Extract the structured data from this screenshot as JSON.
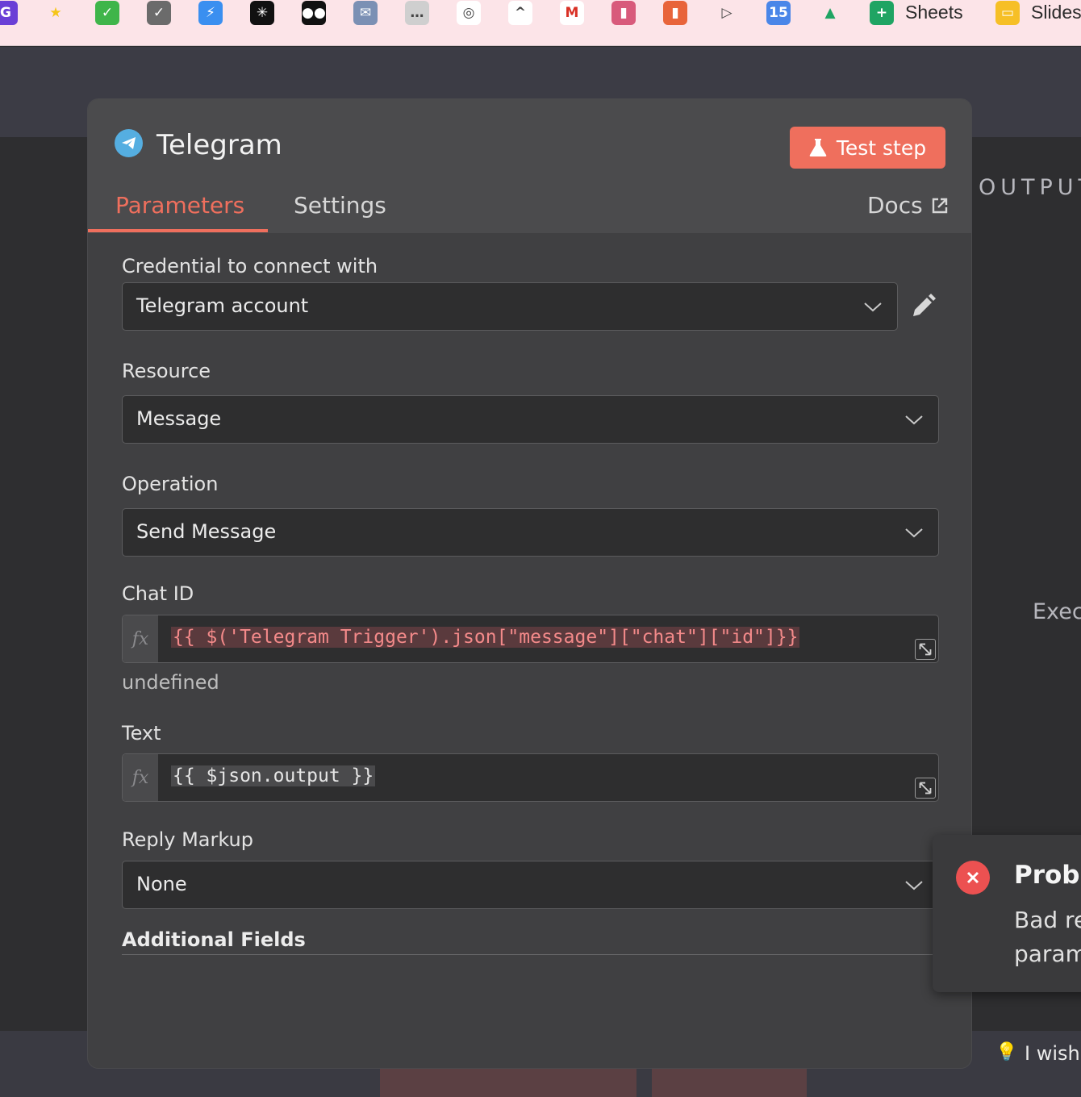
{
  "bookmarks": {
    "items": [
      {
        "icon": "grammarly-icon",
        "glyph": "G",
        "color": "#6a3fd6"
      },
      {
        "icon": "star-icon",
        "glyph": "★",
        "color": "#fce4e8"
      },
      {
        "icon": "green-check-icon",
        "glyph": "✓",
        "color": "#3fb54a"
      },
      {
        "icon": "gray-check-icon",
        "glyph": "✓",
        "color": "#6b6b6b"
      },
      {
        "icon": "bolt-icon",
        "glyph": "⚡",
        "color": "#3a8ff0"
      },
      {
        "icon": "perplexity-icon",
        "glyph": "✳",
        "color": "#111111"
      },
      {
        "icon": "medium-icon",
        "glyph": "●●",
        "color": "#111111"
      },
      {
        "icon": "mail-tray-icon",
        "glyph": "✉",
        "color": "#7b90b4"
      },
      {
        "icon": "chat-bubble-icon",
        "glyph": "…",
        "color": "#cfcfcf"
      },
      {
        "icon": "openai-icon",
        "glyph": "◎",
        "color": "#ffffff"
      },
      {
        "icon": "clickup-icon",
        "glyph": "^",
        "color": "#ffffff"
      },
      {
        "icon": "gmail-icon",
        "glyph": "M",
        "color": "#ffffff"
      },
      {
        "icon": "pages-icon",
        "glyph": "▮",
        "color": "#d85a7b"
      },
      {
        "icon": "bookmark-app-icon",
        "glyph": "▮",
        "color": "#e8643a"
      },
      {
        "icon": "play-icon",
        "glyph": "▷",
        "color": "#fce4e8"
      },
      {
        "icon": "calendar-icon",
        "glyph": "15",
        "color": "#4a86e8"
      },
      {
        "icon": "drive-icon",
        "glyph": "▲",
        "color": "#fce4e8"
      },
      {
        "icon": "sheets-icon",
        "glyph": "+",
        "color": "#1fa463"
      },
      {
        "icon": "slides-icon",
        "glyph": "▭",
        "color": "#f6bf26"
      }
    ],
    "sheets_label": "Sheets",
    "slides_label": "Slides"
  },
  "node": {
    "title": "Telegram",
    "test_step_label": "Test step",
    "tabs": [
      {
        "label": "Parameters",
        "active": true
      },
      {
        "label": "Settings",
        "active": false
      }
    ],
    "docs_label": "Docs"
  },
  "form": {
    "credential": {
      "label": "Credential to connect with",
      "value": "Telegram account"
    },
    "resource": {
      "label": "Resource",
      "value": "Message"
    },
    "operation": {
      "label": "Operation",
      "value": "Send Message"
    },
    "chat_id": {
      "label": "Chat ID",
      "fx": "fx",
      "expression": "{{ $('Telegram Trigger').json[\"message\"][\"chat\"][\"id\"]}}",
      "preview": "undefined"
    },
    "text": {
      "label": "Text",
      "fx": "fx",
      "expression": "{{  $json.output }}"
    },
    "reply_markup": {
      "label": "Reply Markup",
      "value": "None"
    },
    "additional_fields": {
      "label": "Additional Fields"
    }
  },
  "output_panel": {
    "title": "OUTPUT",
    "status": "Exec"
  },
  "toast": {
    "title": "Probl",
    "line1": "Bad re",
    "line2": "param"
  },
  "footer": {
    "wish_text": "I wish"
  },
  "colors": {
    "accent": "#ef6f5d",
    "error": "#ec5151",
    "telegram": "#55aee1"
  }
}
